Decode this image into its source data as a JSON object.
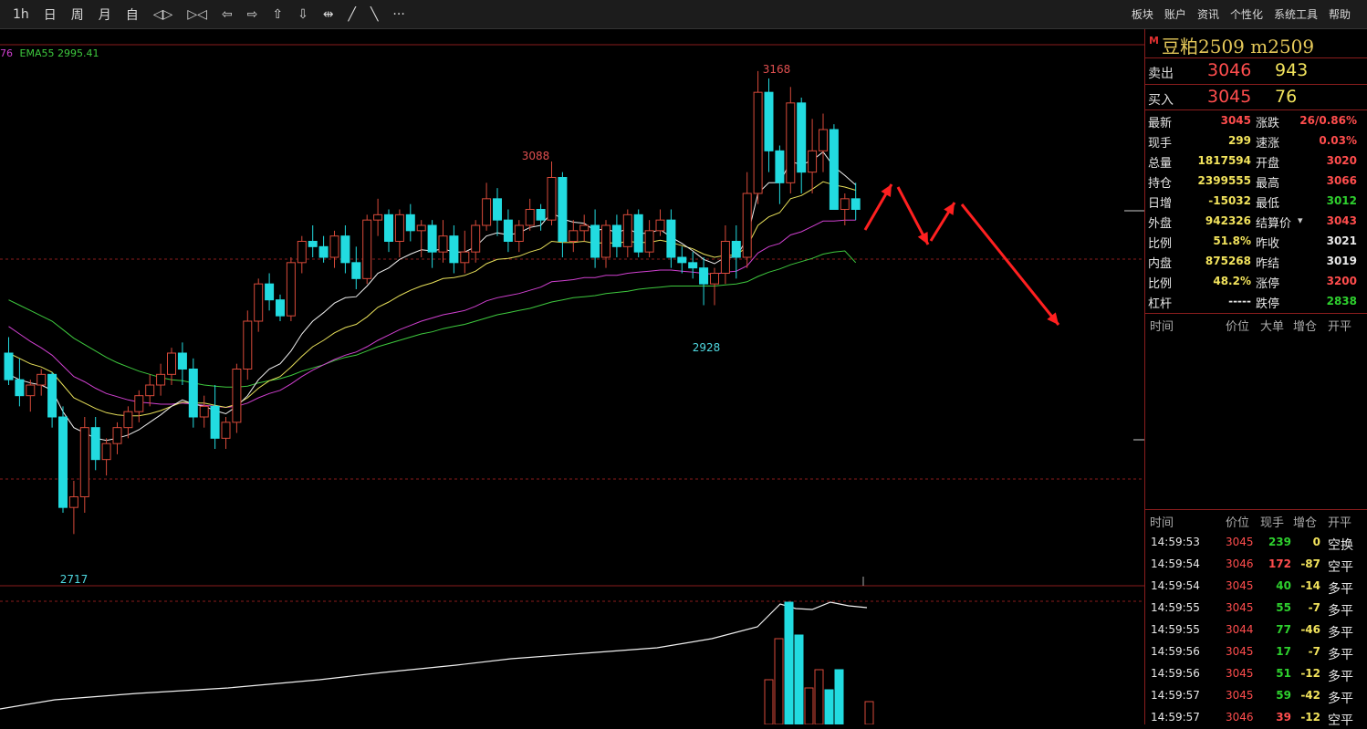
{
  "toolbar": {
    "buttons": [
      "1h",
      "日",
      "周",
      "月",
      "自",
      "◁▷",
      "▷◁",
      "⇦",
      "⇨",
      "⇧",
      "⇩",
      "⇹",
      "╱",
      "╲",
      "···"
    ],
    "menus": [
      "板块",
      "账户",
      "资讯",
      "个性化",
      "系统工具",
      "帮助"
    ]
  },
  "legend": {
    "ema_prev_fragment": "76",
    "ema55": "EMA55 2995.41"
  },
  "chart_labels": {
    "high_1": "3168",
    "high_2": "3088",
    "low_1": "2928",
    "low_2": "2717"
  },
  "colors": {
    "up": "#d84a3a",
    "down": "#22dbe0",
    "ema_white": "#f0f0f0",
    "ema_yellow": "#e8e05a",
    "ema_magenta": "#d040d0",
    "ema_green": "#3ec93e",
    "arrow": "#ff2020",
    "grid": "#8a1d1d"
  },
  "chart_data": {
    "type": "candlestick",
    "ylim": [
      2700,
      3180
    ],
    "candles": [
      [
        2910,
        2925,
        2880,
        2885
      ],
      [
        2885,
        2905,
        2860,
        2870
      ],
      [
        2870,
        2885,
        2855,
        2880
      ],
      [
        2880,
        2895,
        2870,
        2890
      ],
      [
        2890,
        2892,
        2840,
        2850
      ],
      [
        2850,
        2860,
        2760,
        2765
      ],
      [
        2765,
        2790,
        2740,
        2775
      ],
      [
        2775,
        2850,
        2760,
        2840
      ],
      [
        2840,
        2850,
        2800,
        2810
      ],
      [
        2810,
        2830,
        2795,
        2825
      ],
      [
        2825,
        2845,
        2815,
        2840
      ],
      [
        2840,
        2860,
        2830,
        2855
      ],
      [
        2855,
        2875,
        2845,
        2870
      ],
      [
        2870,
        2890,
        2860,
        2880
      ],
      [
        2880,
        2900,
        2870,
        2890
      ],
      [
        2890,
        2915,
        2880,
        2910
      ],
      [
        2910,
        2920,
        2880,
        2895
      ],
      [
        2895,
        2905,
        2840,
        2850
      ],
      [
        2850,
        2870,
        2840,
        2860
      ],
      [
        2860,
        2880,
        2820,
        2830
      ],
      [
        2830,
        2850,
        2820,
        2845
      ],
      [
        2845,
        2900,
        2835,
        2895
      ],
      [
        2895,
        2950,
        2885,
        2940
      ],
      [
        2940,
        2980,
        2930,
        2975
      ],
      [
        2975,
        2985,
        2950,
        2960
      ],
      [
        2960,
        2965,
        2940,
        2945
      ],
      [
        2945,
        3000,
        2940,
        2995
      ],
      [
        2995,
        3020,
        2985,
        3015
      ],
      [
        3015,
        3030,
        3000,
        3010
      ],
      [
        3010,
        3020,
        2995,
        3000
      ],
      [
        3000,
        3025,
        2990,
        3020
      ],
      [
        3020,
        3030,
        2985,
        2995
      ],
      [
        2995,
        3010,
        2970,
        2980
      ],
      [
        2980,
        3040,
        2975,
        3035
      ],
      [
        3035,
        3055,
        3020,
        3040
      ],
      [
        3040,
        3045,
        3005,
        3015
      ],
      [
        3015,
        3045,
        3000,
        3040
      ],
      [
        3040,
        3050,
        3015,
        3025
      ],
      [
        3025,
        3035,
        3000,
        3030
      ],
      [
        3030,
        3035,
        2990,
        3005
      ],
      [
        3005,
        3035,
        2995,
        3020
      ],
      [
        3020,
        3030,
        2985,
        2995
      ],
      [
        2995,
        3025,
        2985,
        3005
      ],
      [
        3005,
        3035,
        2995,
        3030
      ],
      [
        3030,
        3070,
        3025,
        3055
      ],
      [
        3055,
        3065,
        3020,
        3035
      ],
      [
        3035,
        3045,
        3005,
        3015
      ],
      [
        3015,
        3035,
        3005,
        3030
      ],
      [
        3030,
        3055,
        3025,
        3045
      ],
      [
        3045,
        3050,
        3025,
        3035
      ],
      [
        3035,
        3090,
        3030,
        3075
      ],
      [
        3075,
        3080,
        3000,
        3015
      ],
      [
        3015,
        3035,
        3005,
        3025
      ],
      [
        3025,
        3040,
        3015,
        3030
      ],
      [
        3030,
        3045,
        2990,
        3000
      ],
      [
        3000,
        3035,
        2990,
        3030
      ],
      [
        3030,
        3040,
        3000,
        3010
      ],
      [
        3010,
        3045,
        3000,
        3040
      ],
      [
        3040,
        3045,
        3000,
        3005
      ],
      [
        3005,
        3035,
        3000,
        3025
      ],
      [
        3025,
        3045,
        3020,
        3035
      ],
      [
        3035,
        3045,
        2990,
        3000
      ],
      [
        3000,
        3010,
        2985,
        2995
      ],
      [
        2995,
        3005,
        2980,
        2990
      ],
      [
        2990,
        3000,
        2955,
        2975
      ],
      [
        2975,
        2990,
        2955,
        2985
      ],
      [
        2985,
        3030,
        2975,
        3015
      ],
      [
        3015,
        3030,
        2980,
        3000
      ],
      [
        3000,
        3080,
        2990,
        3060
      ],
      [
        3060,
        3175,
        3050,
        3155
      ],
      [
        3155,
        3168,
        3080,
        3100
      ],
      [
        3100,
        3105,
        3050,
        3070
      ],
      [
        3070,
        3160,
        3060,
        3145
      ],
      [
        3145,
        3150,
        3060,
        3080
      ],
      [
        3080,
        3130,
        3060,
        3100
      ],
      [
        3100,
        3135,
        3080,
        3120
      ],
      [
        3120,
        3125,
        3050,
        3045
      ],
      [
        3045,
        3060,
        3030,
        3055
      ],
      [
        3055,
        3070,
        3035,
        3045
      ]
    ],
    "ema_white": [
      2890,
      2885,
      2882,
      2880,
      2875,
      2855,
      2840,
      2835,
      2830,
      2828,
      2830,
      2833,
      2838,
      2845,
      2852,
      2860,
      2866,
      2862,
      2860,
      2856,
      2853,
      2860,
      2870,
      2885,
      2895,
      2900,
      2912,
      2928,
      2940,
      2948,
      2957,
      2962,
      2963,
      2973,
      2985,
      2990,
      2998,
      3003,
      3007,
      3006,
      3008,
      3005,
      3005,
      3010,
      3020,
      3023,
      3021,
      3023,
      3028,
      3030,
      3042,
      3036,
      3033,
      3032,
      3025,
      3027,
      3023,
      3027,
      3022,
      3023,
      3026,
      3019,
      3013,
      3006,
      2998,
      2994,
      3000,
      3000,
      3018,
      3060,
      3070,
      3070,
      3090,
      3087,
      3091,
      3099,
      3085,
      3077,
      3068
    ],
    "ema_yellow": [
      2910,
      2905,
      2900,
      2897,
      2892,
      2880,
      2868,
      2863,
      2858,
      2854,
      2852,
      2851,
      2851,
      2853,
      2856,
      2860,
      2864,
      2863,
      2863,
      2861,
      2859,
      2862,
      2868,
      2877,
      2884,
      2888,
      2897,
      2907,
      2916,
      2922,
      2929,
      2934,
      2937,
      2944,
      2953,
      2958,
      2964,
      2969,
      2973,
      2976,
      2980,
      2981,
      2983,
      2987,
      2994,
      2998,
      2999,
      3001,
      3005,
      3008,
      3015,
      3014,
      3014,
      3015,
      3013,
      3014,
      3013,
      3015,
      3014,
      3014,
      3016,
      3014,
      3011,
      3008,
      3003,
      3000,
      3002,
      3002,
      3010,
      3030,
      3038,
      3042,
      3055,
      3058,
      3064,
      3071,
      3068,
      3066,
      3063
    ],
    "ema_magenta": [
      2935,
      2928,
      2921,
      2915,
      2908,
      2898,
      2888,
      2883,
      2877,
      2872,
      2869,
      2866,
      2864,
      2863,
      2862,
      2862,
      2863,
      2862,
      2861,
      2860,
      2859,
      2860,
      2863,
      2868,
      2872,
      2875,
      2881,
      2888,
      2894,
      2899,
      2904,
      2908,
      2911,
      2916,
      2922,
      2927,
      2932,
      2936,
      2940,
      2943,
      2946,
      2948,
      2950,
      2954,
      2959,
      2962,
      2964,
      2966,
      2969,
      2972,
      2977,
      2978,
      2979,
      2981,
      2981,
      2983,
      2983,
      2985,
      2986,
      2987,
      2988,
      2988,
      2987,
      2986,
      2985,
      2984,
      2986,
      2987,
      2992,
      3004,
      3010,
      3013,
      3021,
      3024,
      3029,
      3034,
      3034,
      3035,
      3035
    ],
    "ema_green": [
      2960,
      2955,
      2950,
      2945,
      2940,
      2932,
      2924,
      2918,
      2912,
      2906,
      2901,
      2897,
      2893,
      2890,
      2887,
      2885,
      2884,
      2882,
      2880,
      2879,
      2878,
      2878,
      2879,
      2882,
      2884,
      2886,
      2889,
      2893,
      2896,
      2899,
      2903,
      2906,
      2908,
      2912,
      2916,
      2919,
      2922,
      2925,
      2928,
      2930,
      2933,
      2935,
      2937,
      2940,
      2943,
      2946,
      2948,
      2950,
      2952,
      2955,
      2958,
      2960,
      2962,
      2963,
      2964,
      2966,
      2967,
      2968,
      2970,
      2971,
      2972,
      2973,
      2973,
      2973,
      2973,
      2973,
      2974,
      2975,
      2977,
      2982,
      2986,
      2989,
      2993,
      2996,
      2999,
      3003,
      3005,
      3006,
      2995
    ]
  },
  "quote": {
    "title": "豆粕2509  m2509",
    "title_mark": "M",
    "ask_label": "卖出",
    "ask_price": "3046",
    "ask_vol": "943",
    "bid_label": "买入",
    "bid_price": "3045",
    "bid_vol": "76"
  },
  "stats": [
    {
      "k": "最新",
      "v": "3045",
      "c": "red"
    },
    {
      "k": "涨跌",
      "v": "26/0.86%",
      "c": "red"
    },
    {
      "k": "现手",
      "v": "299",
      "c": "yellow"
    },
    {
      "k": "速涨",
      "v": "0.03%",
      "c": "red"
    },
    {
      "k": "总量",
      "v": "1817594",
      "c": "yellow"
    },
    {
      "k": "开盘",
      "v": "3020",
      "c": "red"
    },
    {
      "k": "持仓",
      "v": "2399555",
      "c": "yellow"
    },
    {
      "k": "最高",
      "v": "3066",
      "c": "red"
    },
    {
      "k": "日增",
      "v": "-15032",
      "c": "yellow"
    },
    {
      "k": "最低",
      "v": "3012",
      "c": "green"
    },
    {
      "k": "外盘",
      "v": "942326",
      "c": "yellow"
    },
    {
      "k": "结算价",
      "v": "3043",
      "c": "red"
    },
    {
      "k": "比例",
      "v": "51.8%",
      "c": "yellow"
    },
    {
      "k": "昨收",
      "v": "3021",
      "c": "white"
    },
    {
      "k": "内盘",
      "v": "875268",
      "c": "yellow"
    },
    {
      "k": "昨结",
      "v": "3019",
      "c": "white"
    },
    {
      "k": "比例",
      "v": "48.2%",
      "c": "yellow"
    },
    {
      "k": "涨停",
      "v": "3200",
      "c": "red"
    },
    {
      "k": "杠杆",
      "v": "-----",
      "c": "white"
    },
    {
      "k": "跌停",
      "v": "2838",
      "c": "green"
    }
  ],
  "settle_arrow": "▾",
  "big_order_header": [
    "时间",
    "价位",
    "大单",
    "增仓",
    "开平"
  ],
  "tick_header": [
    "时间",
    "价位",
    "现手",
    "增仓",
    "开平"
  ],
  "ticks": [
    {
      "t": "14:59:53",
      "p": "3045",
      "q": "239",
      "d": "0",
      "o": "空换",
      "qc": "green"
    },
    {
      "t": "14:59:54",
      "p": "3046",
      "q": "172",
      "d": "-87",
      "o": "空平",
      "qc": "red"
    },
    {
      "t": "14:59:54",
      "p": "3045",
      "q": "40",
      "d": "-14",
      "o": "多平",
      "qc": "green"
    },
    {
      "t": "14:59:55",
      "p": "3045",
      "q": "55",
      "d": "-7",
      "o": "多平",
      "qc": "green"
    },
    {
      "t": "14:59:55",
      "p": "3044",
      "q": "77",
      "d": "-46",
      "o": "多平",
      "qc": "green"
    },
    {
      "t": "14:59:56",
      "p": "3045",
      "q": "17",
      "d": "-7",
      "o": "多平",
      "qc": "green"
    },
    {
      "t": "14:59:56",
      "p": "3045",
      "q": "51",
      "d": "-12",
      "o": "多平",
      "qc": "green"
    },
    {
      "t": "14:59:57",
      "p": "3045",
      "q": "59",
      "d": "-42",
      "o": "多平",
      "qc": "green"
    },
    {
      "t": "14:59:57",
      "p": "3046",
      "q": "39",
      "d": "-12",
      "o": "空平",
      "qc": "red"
    }
  ]
}
